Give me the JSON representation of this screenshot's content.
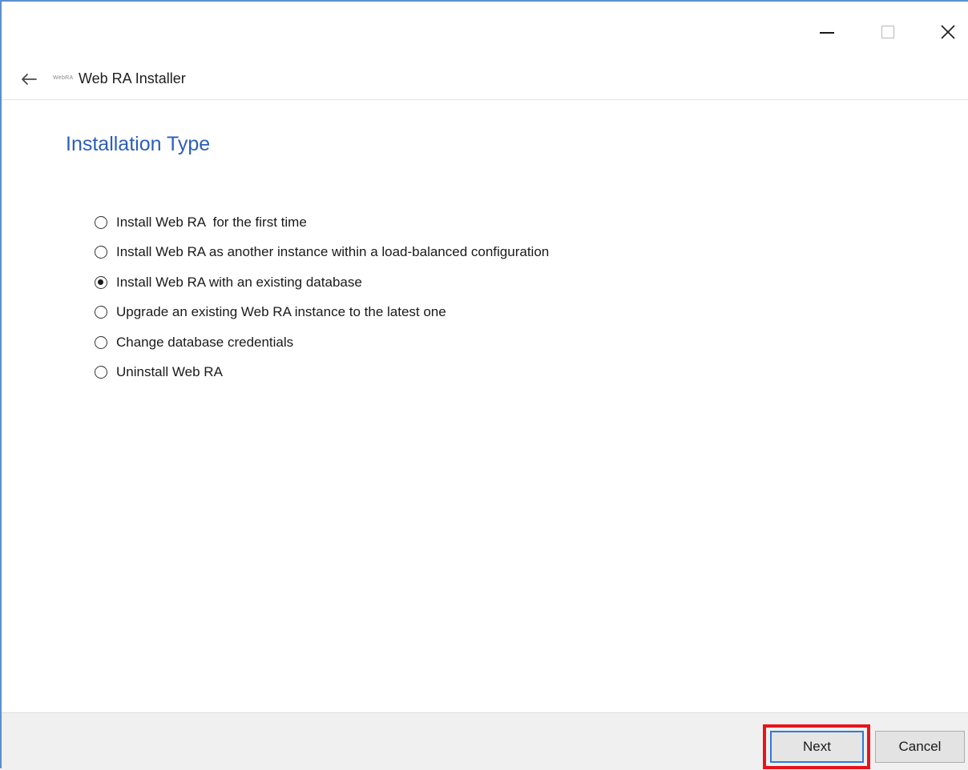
{
  "window": {
    "title": "Web RA  Installer",
    "logo_text": "WebRA",
    "accent_color": "#2b5fb8",
    "highlight_color": "#e8141b"
  },
  "caption_buttons": {
    "minimize_icon": "minimize-icon",
    "maximize_icon": "maximize-icon",
    "close_icon": "close-icon"
  },
  "page": {
    "heading": "Installation Type"
  },
  "options": [
    {
      "label": "Install Web RA  for the first time",
      "selected": false
    },
    {
      "label": "Install Web RA as another instance within a load-balanced configuration",
      "selected": false
    },
    {
      "label": "Install Web RA with an existing database",
      "selected": true
    },
    {
      "label": "Upgrade an existing Web RA instance to the latest one",
      "selected": false
    },
    {
      "label": "Change database credentials",
      "selected": false
    },
    {
      "label": "Uninstall Web RA",
      "selected": false
    }
  ],
  "footer": {
    "next_label": "Next",
    "cancel_label": "Cancel"
  }
}
